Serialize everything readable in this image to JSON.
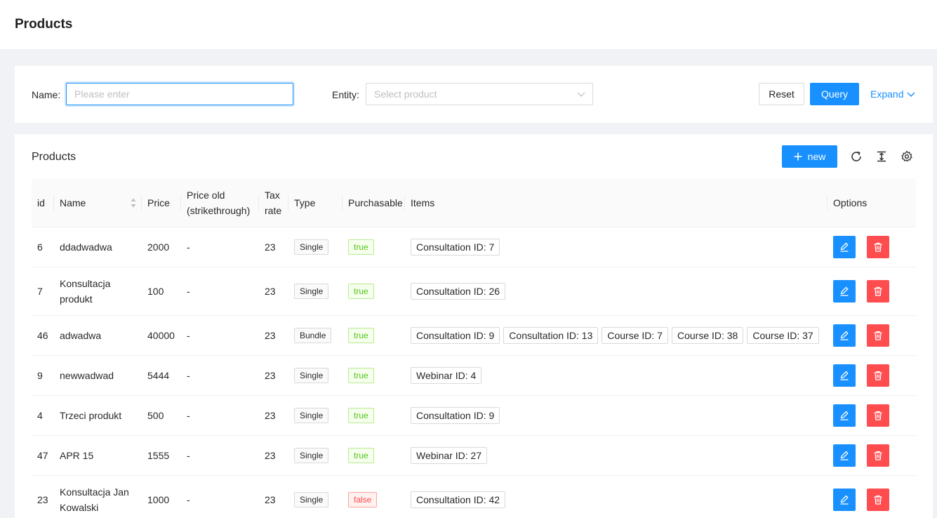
{
  "page": {
    "title": "Products"
  },
  "search": {
    "name_label": "Name",
    "name_placeholder": "Please enter",
    "entity_label": "Entity",
    "entity_placeholder": "Select product",
    "reset_label": "Reset",
    "query_label": "Query",
    "expand_label": "Expand"
  },
  "table_card": {
    "title": "Products",
    "new_label": "new",
    "toolbar_icons": [
      "reload-icon",
      "density-icon",
      "settings-icon"
    ]
  },
  "table": {
    "columns": {
      "id": "id",
      "name": "Name",
      "price": "Price",
      "price_old_1": "Price old",
      "price_old_2": "(strikethrough)",
      "tax_1": "Tax",
      "tax_2": "rate",
      "type": "Type",
      "purchasable": "Purchasable",
      "items": "Items",
      "options": "Options"
    },
    "rows": [
      {
        "id": "6",
        "name": "ddadwadwa",
        "price": "2000",
        "price_old": "-",
        "tax": "23",
        "type": "Single",
        "purchasable": "true",
        "items": [
          "Consultation ID: 7"
        ]
      },
      {
        "id": "7",
        "name": "Konsultacja produkt",
        "price": "100",
        "price_old": "-",
        "tax": "23",
        "type": "Single",
        "purchasable": "true",
        "items": [
          "Consultation ID: 26"
        ]
      },
      {
        "id": "46",
        "name": "adwadwa",
        "price": "40000",
        "price_old": "-",
        "tax": "23",
        "type": "Bundle",
        "purchasable": "true",
        "items": [
          "Consultation ID: 9",
          "Consultation ID: 13",
          "Course ID: 7",
          "Course ID: 38",
          "Course ID: 37"
        ]
      },
      {
        "id": "9",
        "name": "newwadwad",
        "price": "5444",
        "price_old": "-",
        "tax": "23",
        "type": "Single",
        "purchasable": "true",
        "items": [
          "Webinar ID: 4"
        ]
      },
      {
        "id": "4",
        "name": "Trzeci produkt",
        "price": "500",
        "price_old": "-",
        "tax": "23",
        "type": "Single",
        "purchasable": "true",
        "items": [
          "Consultation ID: 9"
        ]
      },
      {
        "id": "47",
        "name": "APR 15",
        "price": "1555",
        "price_old": "-",
        "tax": "23",
        "type": "Single",
        "purchasable": "true",
        "items": [
          "Webinar ID: 27"
        ]
      },
      {
        "id": "23",
        "name": "Konsultacja Jan Kowalski",
        "price": "1000",
        "price_old": "-",
        "tax": "23",
        "type": "Single",
        "purchasable": "false",
        "items": [
          "Consultation ID: 42"
        ]
      }
    ]
  },
  "colors": {
    "primary": "#1890ff",
    "danger": "#ff4d4f",
    "success": "#52c41a"
  }
}
